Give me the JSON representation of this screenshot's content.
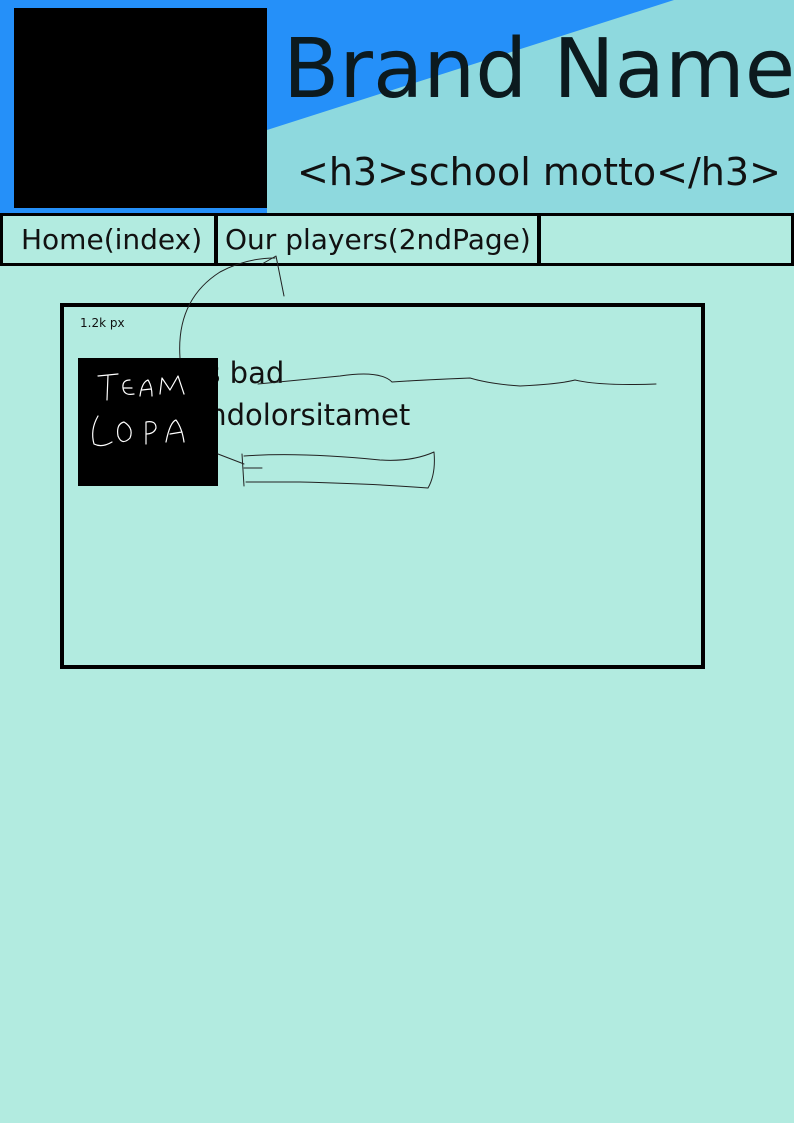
{
  "header": {
    "brand_name": "Brand Name",
    "motto": "<h3>school motto</h3>",
    "colors": {
      "primary_blue": "#2590f9",
      "light_teal": "#8ed9de",
      "logo": "#000000"
    },
    "logo_icon": "logo-placeholder"
  },
  "nav": {
    "items": [
      {
        "label": "Home(index)"
      },
      {
        "label": "Our players(2ndPage)"
      },
      {
        "label": ""
      }
    ]
  },
  "content": {
    "size_note": "1.2k px",
    "lines": [
      "l is bad",
      "umdolorsitamet"
    ],
    "image": {
      "handwritten_text": "TEAM LOPA"
    }
  },
  "page": {
    "background": "#b2ebe0"
  }
}
